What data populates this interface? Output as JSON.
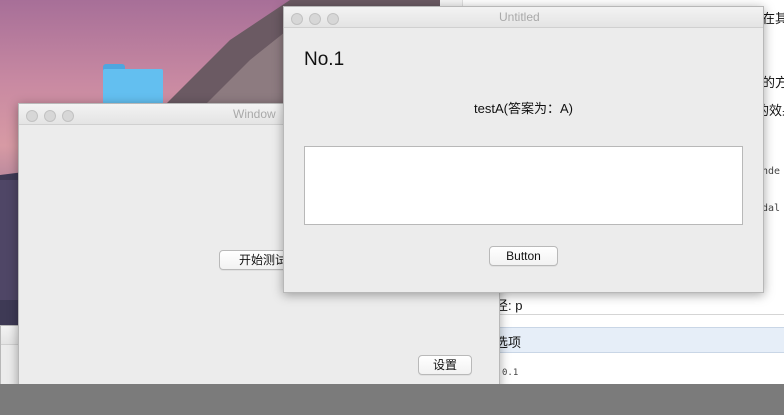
{
  "back_window": {
    "title": "Window",
    "start_button": "开始测试",
    "settings_button": "设置"
  },
  "front_window": {
    "title": "Untitled",
    "heading": "No.1",
    "question": "testA(答案为：A)",
    "answer_value": "",
    "button": "Button"
  },
  "editor": {
    "line1": "在其",
    "line2": "的方",
    "line3": "的效果",
    "code1": "nde",
    "code2": "dal",
    "path_label": "径: p",
    "options_label": "选项",
    "bottom_fragment": "0.1"
  }
}
